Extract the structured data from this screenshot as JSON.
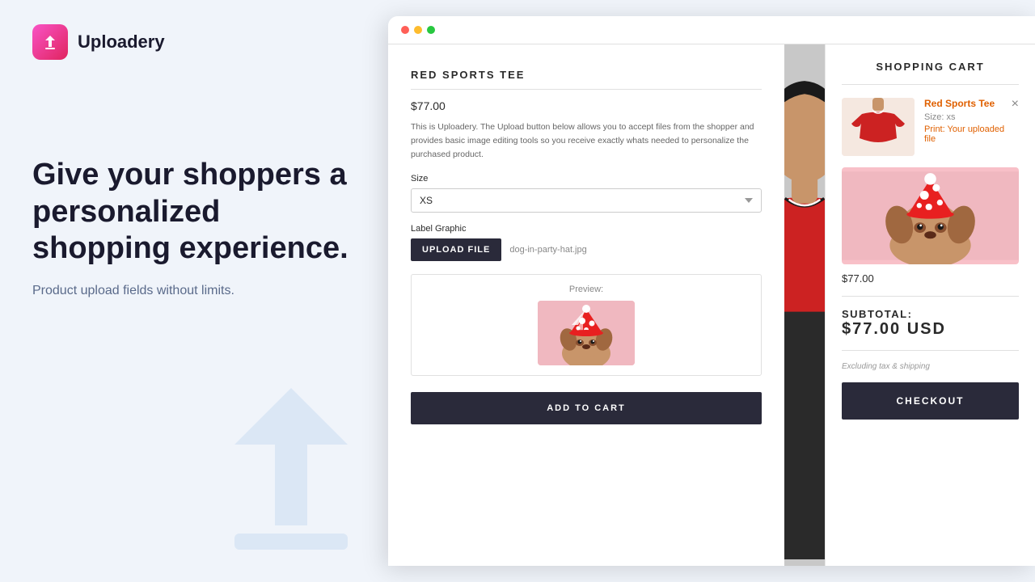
{
  "brand": {
    "logo_label": "Uploadery",
    "logo_icon": "↑"
  },
  "hero": {
    "title": "Give your shoppers a personalized shopping experience.",
    "subtitle": "Product upload fields without limits."
  },
  "browser": {
    "dots": [
      "dot1",
      "dot2",
      "dot3"
    ]
  },
  "product": {
    "title": "RED SPORTS TEE",
    "price": "$77.00",
    "description": "This is Uploadery. The Upload button below allows you to accept files from the shopper and provides basic image editing tools so you receive exactly whats needed to personalize the purchased product.",
    "size_label": "Size",
    "size_value": "XS",
    "upload_label": "Label Graphic",
    "upload_button": "UPLOAD FILE",
    "uploaded_filename": "dog-in-party-hat.jpg",
    "preview_label": "Preview:",
    "add_to_cart_button": "ADD TO CART"
  },
  "cart": {
    "title": "SHOPPING CART",
    "close_icon": "×",
    "item": {
      "name": "Red Sports Tee",
      "size": "Size: xs",
      "print_label": "Print: ",
      "print_value": "Your uploaded file",
      "price": "$77.00"
    },
    "subtotal_label": "SUBTOTAL:",
    "subtotal_amount": "$77.00 USD",
    "tax_note": "Excluding tax & shipping",
    "checkout_button": "CHECKOUT"
  }
}
